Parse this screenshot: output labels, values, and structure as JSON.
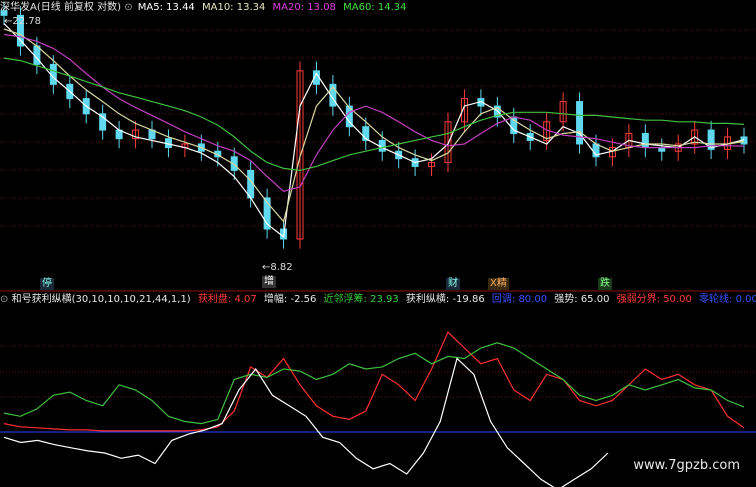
{
  "price_header": {
    "title": "深华发A(日线 前复权 对数)",
    "ma5": "MA5: 13.44",
    "ma10": "MA10: 13.34",
    "ma20": "MA20: 13.08",
    "ma60": "MA60: 14.34"
  },
  "price_annotations": {
    "high": "22.78",
    "low": "8.82"
  },
  "signal_tags": [
    "停",
    "增",
    "财",
    "X精",
    "跌"
  ],
  "indicator_header": {
    "name": "和号获利纵横(30,10,10,10,21,44,1,1)",
    "items": [
      {
        "label": "获利盘: 4.07",
        "color": "#ff3c3c"
      },
      {
        "label": "增幅: -2.56",
        "color": "#e8e8e8"
      },
      {
        "label": "近邻浮筹: 23.93",
        "color": "#35d035"
      },
      {
        "label": "获利纵横: -19.86",
        "color": "#e8e8e8"
      },
      {
        "label": "回调: 80.00",
        "color": "#3a52ff"
      },
      {
        "label": "强势: 65.00",
        "color": "#e8e8e8"
      },
      {
        "label": "强弱分界: 50.00",
        "color": "#ff3c3c"
      },
      {
        "label": "零轮线: 0.00",
        "color": "#3a52ff"
      }
    ]
  },
  "watermark": "www.7gpzb.com",
  "colors": {
    "up": "#ff3c3c",
    "down": "#5fd8f0",
    "ma5": "#ffffff",
    "ma10": "#d8d8a0",
    "ma20": "#c040c0",
    "ma60": "#40c040",
    "grid": "#6a1010",
    "profit": "#ff3030",
    "floating": "#40c040",
    "zongheng": "#ffffff",
    "zero_line": "#3040ff"
  },
  "chart_data": [
    {
      "type": "line",
      "title": "深华发A(日线 前复权 对数)",
      "series": [
        {
          "name": "MA5",
          "values": [
            22.0,
            20.5,
            19.0,
            17.5,
            16.5,
            15.5,
            14.8,
            14.0,
            13.6,
            13.4,
            13.2,
            13.0,
            12.7,
            12.2,
            11.5,
            10.5,
            9.4,
            8.9,
            15.5,
            17.8,
            16.0,
            14.5,
            13.5,
            13.0,
            12.6,
            12.2,
            12.4,
            13.2,
            15.5,
            15.8,
            15.2,
            14.0,
            13.6,
            13.2,
            14.2,
            13.8,
            12.6,
            12.8,
            13.4,
            13.2,
            13.1,
            13.0,
            13.6,
            13.0,
            13.2,
            13.44
          ]
        },
        {
          "name": "MA10",
          "values": [
            21.5,
            21.0,
            20.0,
            18.8,
            17.6,
            16.6,
            15.8,
            15.0,
            14.4,
            14.0,
            13.6,
            13.3,
            13.0,
            12.6,
            12.1,
            11.3,
            10.3,
            9.5,
            12.5,
            15.5,
            16.8,
            15.4,
            14.5,
            13.6,
            13.0,
            12.6,
            12.3,
            12.7,
            13.9,
            15.0,
            15.4,
            14.6,
            14.0,
            13.5,
            13.8,
            13.9,
            13.2,
            12.8,
            13.0,
            13.2,
            13.2,
            13.1,
            13.3,
            13.2,
            13.2,
            13.34
          ]
        },
        {
          "name": "MA20",
          "values": [
            21.0,
            20.8,
            20.4,
            19.8,
            18.9,
            17.8,
            16.8,
            16.0,
            15.4,
            14.9,
            14.4,
            13.9,
            13.5,
            13.1,
            12.8,
            12.3,
            11.5,
            10.8,
            11.0,
            12.6,
            14.0,
            15.1,
            15.5,
            15.1,
            14.5,
            13.9,
            13.4,
            13.1,
            13.2,
            13.8,
            14.4,
            14.8,
            14.6,
            14.0,
            13.7,
            13.6,
            13.5,
            13.3,
            13.1,
            13.0,
            13.0,
            13.0,
            13.0,
            13.1,
            13.1,
            13.08
          ]
        },
        {
          "name": "MA60",
          "values": [
            19.0,
            18.8,
            18.4,
            18.0,
            17.6,
            17.2,
            16.8,
            16.4,
            16.1,
            15.8,
            15.5,
            15.2,
            14.8,
            14.3,
            13.6,
            12.8,
            12.2,
            11.9,
            11.8,
            12.0,
            12.3,
            12.6,
            12.8,
            13.0,
            13.2,
            13.4,
            13.6,
            13.8,
            14.2,
            14.6,
            14.9,
            15.1,
            15.1,
            15.1,
            15.0,
            14.9,
            14.9,
            14.8,
            14.7,
            14.6,
            14.6,
            14.5,
            14.5,
            14.4,
            14.4,
            14.34
          ]
        }
      ],
      "candles": [
        22.78,
        20.0,
        18.5,
        17.0,
        16.0,
        15.0,
        14.0,
        13.5,
        14.0,
        13.5,
        13.0,
        13.2,
        12.8,
        12.5,
        11.8,
        10.5,
        9.2,
        8.82,
        18.0,
        17.0,
        15.5,
        14.2,
        13.4,
        12.8,
        12.4,
        12.0,
        12.2,
        14.5,
        16.0,
        15.5,
        14.8,
        13.8,
        13.4,
        14.5,
        15.8,
        13.2,
        12.5,
        13.0,
        13.8,
        13.0,
        12.8,
        13.2,
        14.0,
        12.9,
        13.6,
        13.2
      ]
    },
    {
      "type": "line",
      "title": "和号获利纵横(30,10,10,10,21,44,1,1)",
      "series": [
        {
          "name": "获利盘",
          "values": [
            8,
            5,
            4,
            3,
            2,
            2,
            1,
            1,
            1,
            1,
            1,
            1,
            2,
            5,
            20,
            62,
            52,
            70,
            45,
            25,
            15,
            12,
            20,
            55,
            45,
            30,
            60,
            95,
            80,
            65,
            70,
            40,
            30,
            55,
            50,
            30,
            25,
            30,
            45,
            60,
            50,
            55,
            45,
            40,
            15,
            4.07
          ]
        },
        {
          "name": "近邻浮筹",
          "values": [
            18,
            15,
            22,
            35,
            38,
            30,
            25,
            45,
            40,
            30,
            15,
            10,
            8,
            12,
            50,
            55,
            52,
            60,
            58,
            50,
            55,
            65,
            60,
            62,
            70,
            75,
            65,
            72,
            70,
            80,
            85,
            80,
            70,
            60,
            50,
            35,
            30,
            35,
            45,
            40,
            45,
            50,
            42,
            40,
            30,
            23.93
          ]
        },
        {
          "name": "获利纵横",
          "values": [
            -5,
            -10,
            -8,
            -12,
            -15,
            -18,
            -20,
            -25,
            -22,
            -30,
            -8,
            -2,
            2,
            8,
            40,
            60,
            35,
            25,
            15,
            -5,
            -10,
            -25,
            -35,
            -30,
            -40,
            -20,
            10,
            70,
            55,
            10,
            -15,
            -30,
            -45,
            -55,
            -45,
            -35,
            -20
          ]
        }
      ]
    }
  ]
}
